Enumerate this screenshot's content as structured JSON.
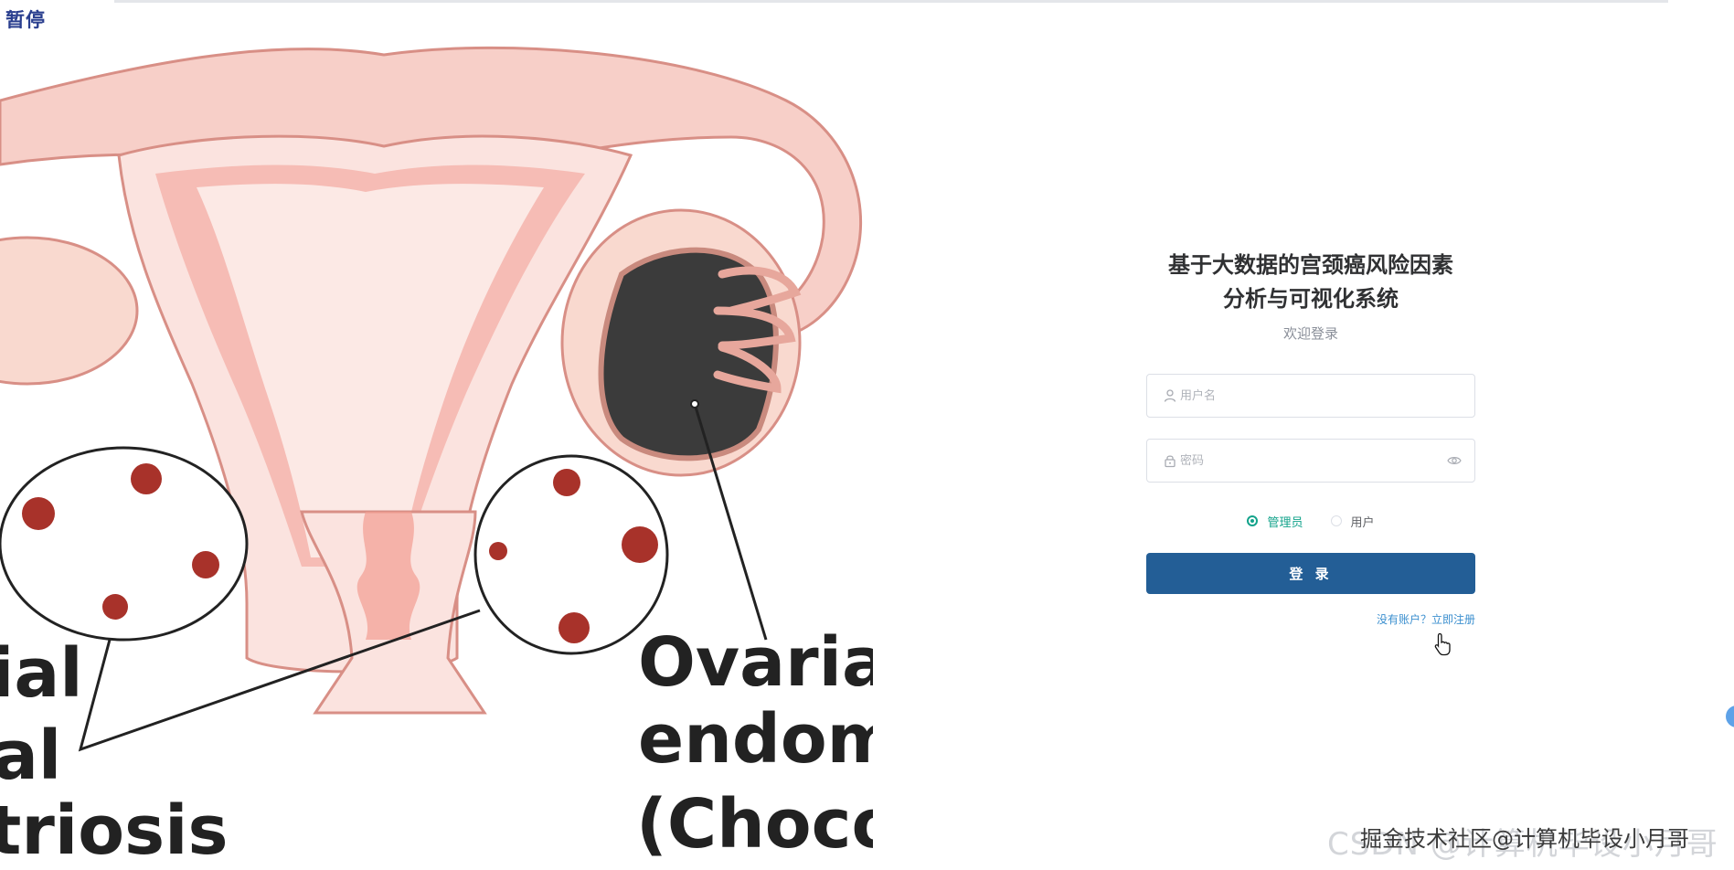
{
  "overlay": {
    "pause_label": "暂停"
  },
  "illustration": {
    "captions": {
      "left_line_1": "ial",
      "left_line_2": "al",
      "left_line_3": "triosis",
      "right_line_1": "Ovaria",
      "right_line_2": "endom",
      "right_line_3": "(Chocol"
    }
  },
  "login": {
    "title": "基于大数据的宫颈癌风险因素\n分析与可视化系统",
    "subtitle": "欢迎登录",
    "username": {
      "placeholder": "用户名",
      "value": "",
      "icon": "user-icon"
    },
    "password": {
      "placeholder": "密码",
      "value": "",
      "icon": "lock-icon",
      "toggle_icon": "eye-icon"
    },
    "roles": [
      {
        "label": "管理员",
        "selected": true
      },
      {
        "label": "用户",
        "selected": false
      }
    ],
    "submit_label": "登 录",
    "register_link": "没有账户？立即注册"
  },
  "watermark": {
    "back": "CSDN @计算机毕设小月哥",
    "front": "掘金技术社区@计算机毕设小月哥"
  },
  "colors": {
    "primary_button": "#235e96",
    "radio_active": "#13a38b",
    "link": "#3b8fcf"
  }
}
